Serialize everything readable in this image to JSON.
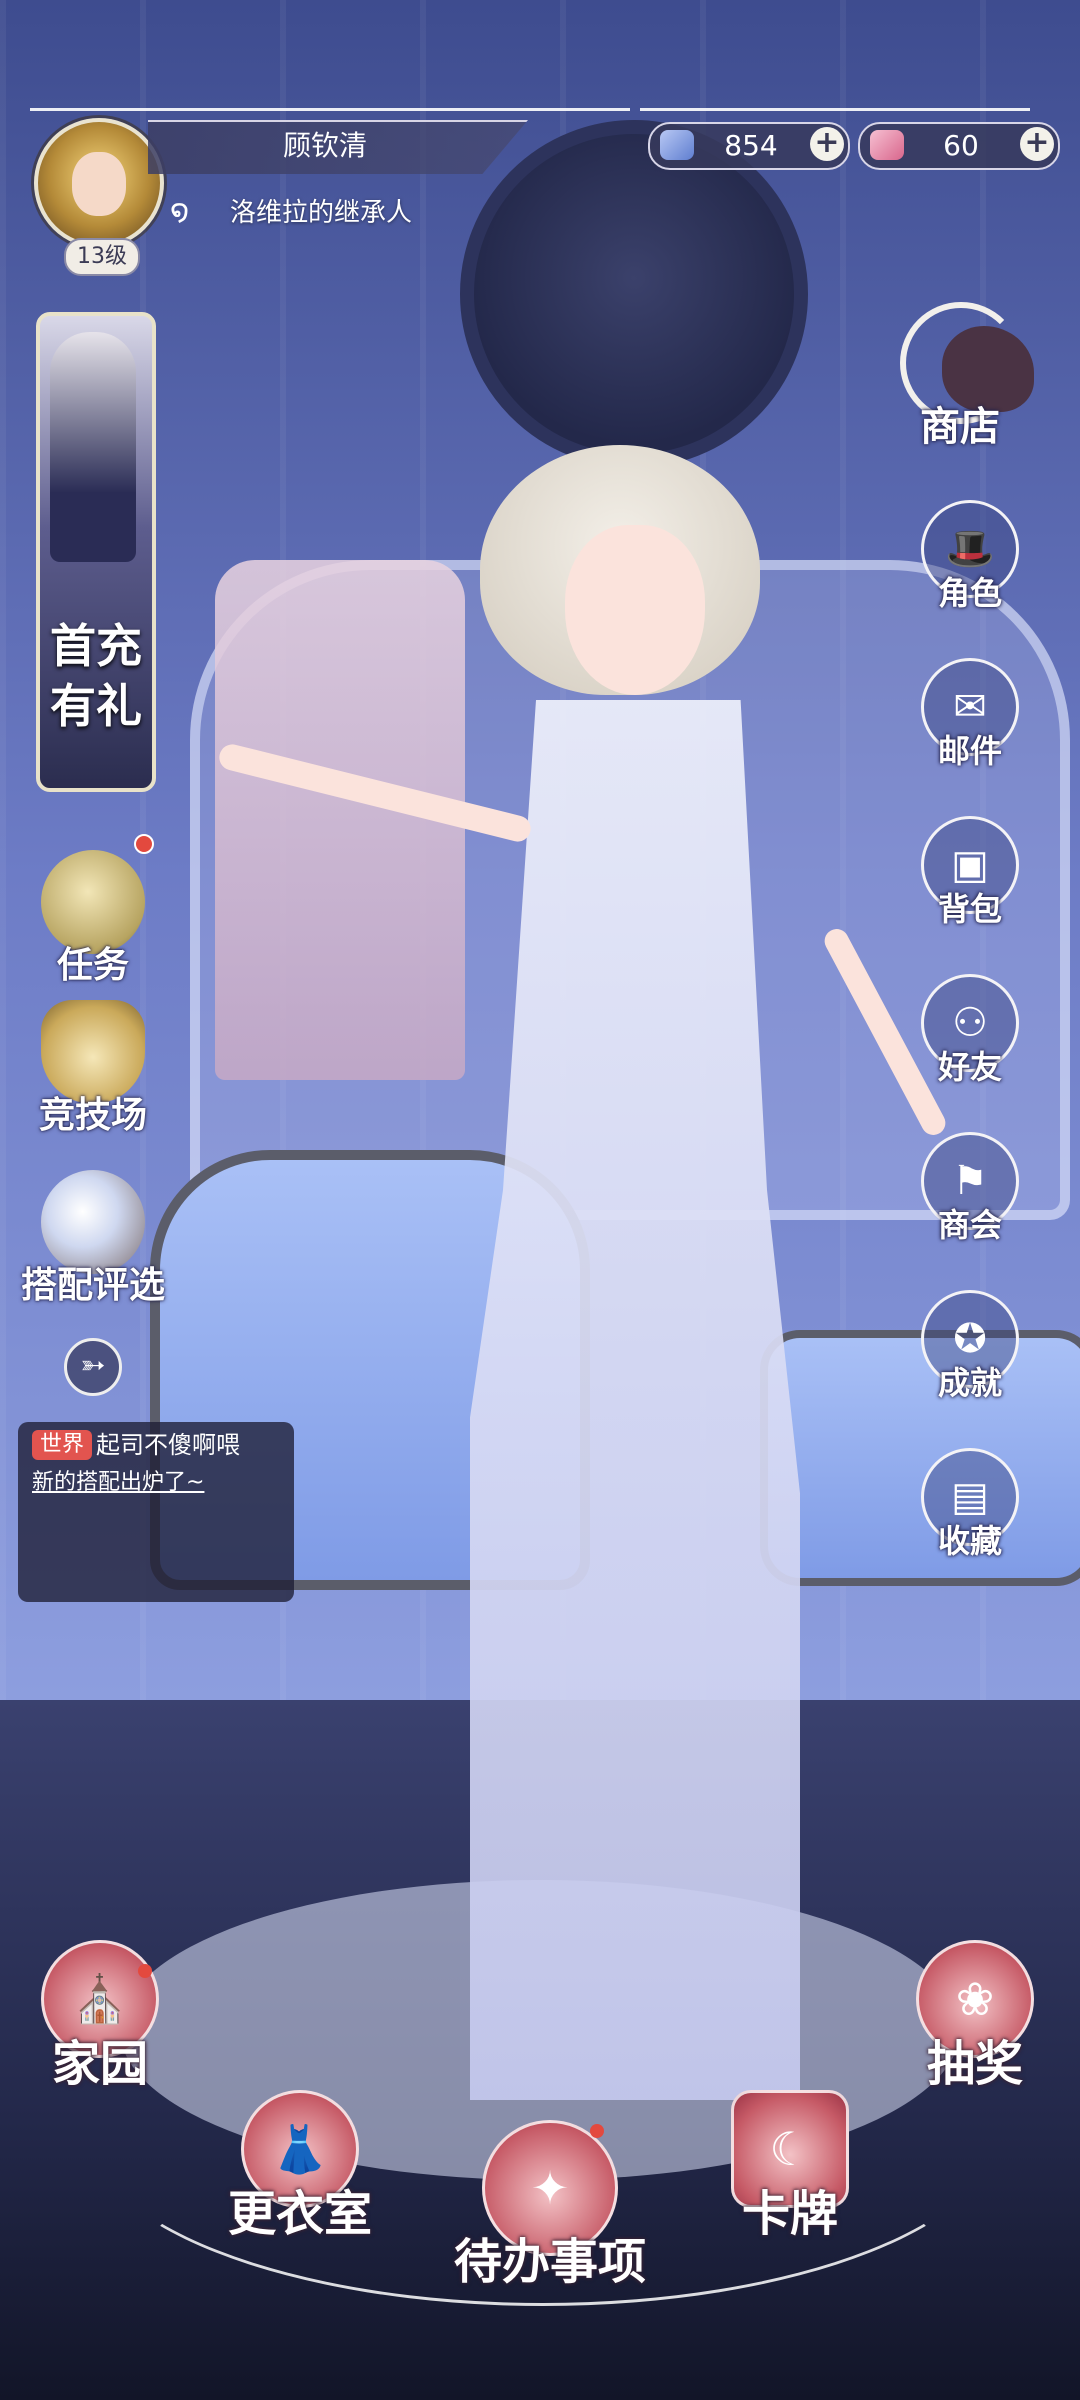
{
  "player": {
    "name": "顾钦清",
    "title": "洛维拉的继承人",
    "level": "13级"
  },
  "currencies": [
    {
      "icon": "crystal-icon",
      "value": "854",
      "color": "#6f8fd6"
    },
    {
      "icon": "gem-icon",
      "value": "60",
      "color": "#e68aa6"
    }
  ],
  "left_menu": {
    "promo": "首充有礼",
    "items": [
      {
        "label": "任务",
        "icon": "quest-orb-icon",
        "has_dot": true
      },
      {
        "label": "竞技场",
        "icon": "trophy-icon",
        "has_dot": false
      },
      {
        "label": "搭配评选",
        "icon": "crystal-ball-icon",
        "has_dot": false
      }
    ]
  },
  "chat": {
    "channel": "世界",
    "user": "起司不傻啊喂",
    "message": "新的搭配出炉了~"
  },
  "right_menu": {
    "shop": "商店",
    "items": [
      {
        "label": "角色",
        "icon": "hat-icon"
      },
      {
        "label": "邮件",
        "icon": "mail-icon"
      },
      {
        "label": "背包",
        "icon": "bag-icon"
      },
      {
        "label": "好友",
        "icon": "friends-icon"
      },
      {
        "label": "商会",
        "icon": "banner-icon"
      },
      {
        "label": "成就",
        "icon": "medal-icon"
      },
      {
        "label": "收藏",
        "icon": "book-icon"
      }
    ]
  },
  "bottom_nav": [
    {
      "label": "家园",
      "icon": "cathedral-icon",
      "has_dot": true
    },
    {
      "label": "更衣室",
      "icon": "dress-icon",
      "has_dot": false
    },
    {
      "label": "待办事项",
      "icon": "raven-icon",
      "has_dot": true
    },
    {
      "label": "卡牌",
      "icon": "card-icon",
      "has_dot": false
    },
    {
      "label": "抽奖",
      "icon": "rose-icon",
      "has_dot": false
    }
  ]
}
